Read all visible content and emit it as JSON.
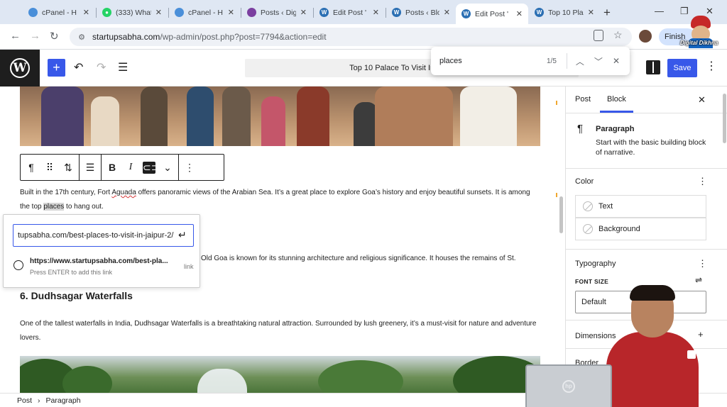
{
  "browser": {
    "tabs": [
      {
        "title": "cPanel - H",
        "icon": "cpanel-icon",
        "color": "#4a8fd9"
      },
      {
        "title": "(333) What",
        "icon": "whatsapp-icon",
        "color": "#25d366"
      },
      {
        "title": "cPanel - H",
        "icon": "cpanel-icon",
        "color": "#4a8fd9"
      },
      {
        "title": "Posts ‹ Dig",
        "icon": "rocket-icon",
        "color": "#7b3fa0"
      },
      {
        "title": "Edit Post '",
        "icon": "wordpress-icon",
        "color": "#2b6fb3"
      },
      {
        "title": "Posts ‹ Blo",
        "icon": "wordpress-icon",
        "color": "#2b6fb3"
      },
      {
        "title": "Edit Post '",
        "icon": "wordpress-icon",
        "color": "#2b6fb3"
      },
      {
        "title": "Top 10 Pla",
        "icon": "wordpress-icon",
        "color": "#2b6fb3"
      }
    ],
    "active_tab_index": 6,
    "url_host": "startupsabha.com",
    "url_path": "/wp-admin/post.php?post=7794&action=edit",
    "profile_button": "Finish",
    "logo_text": "Digital Dikhna"
  },
  "find": {
    "query": "places",
    "count": "1/5"
  },
  "wp": {
    "doc_title": "Top 10 Palace To Visit In Goa · Post",
    "save_label": "Save"
  },
  "content": {
    "para1_before": "Built in the 17th century, Fort ",
    "para1_misspelled": "Aguada",
    "para1_mid": " offers panoramic views of the Arabian Sea. It’s a great place to explore Goa’s history and enjoy beautiful sunsets. It is among the top ",
    "para1_highlight": "places",
    "para1_after": " to hang out.",
    "para2_visible": "Old Goa is known for its stunning architecture and religious significance. It houses the remains of St.",
    "heading": "6. Dudhsagar Waterfalls",
    "para3": "One of the tallest waterfalls in India, Dudhsagar Waterfalls is a breathtaking natural attraction. Surrounded by lush greenery, it’s a must-visit for nature and adventure lovers."
  },
  "link_popover": {
    "input_value": "tupsabha.com/best-places-to-visit-in-jaipur-2/",
    "suggestion_url": "https://www.startupsabha.com/best-pla...",
    "suggestion_hint": "Press ENTER to add this link",
    "suggestion_type": "link"
  },
  "sidebar": {
    "tab_post": "Post",
    "tab_block": "Block",
    "block_name": "Paragraph",
    "block_desc": "Start with the basic building block of narrative.",
    "color_title": "Color",
    "color_text": "Text",
    "color_background": "Background",
    "typography_title": "Typography",
    "font_size_label": "FONT SIZE",
    "font_size_value": "Default",
    "dimensions_title": "Dimensions",
    "border_title": "Border"
  },
  "breadcrumb": {
    "root": "Post",
    "current": "Paragraph"
  },
  "colors": {
    "wp_accent": "#3858e9",
    "dark": "#1e1e1e",
    "progress_orange": "#f0a830"
  }
}
